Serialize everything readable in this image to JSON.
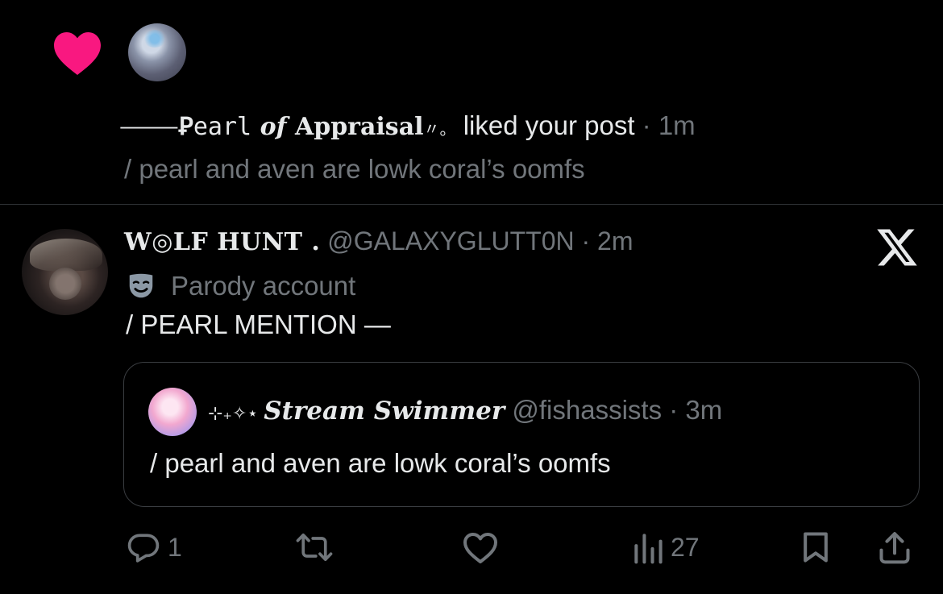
{
  "notification": {
    "liker_name_parts": {
      "dash": "⸻",
      "p1": "Ꝑ",
      "p2": "earl",
      "p3": " of ",
      "p4": "Appraisal",
      "p5": "〃。"
    },
    "action_text": " liked your post",
    "separator": " · ",
    "time": "1m",
    "snippet": "/  pearl and aven are lowk coral’s oomfs"
  },
  "post": {
    "display_name": "W◎LF HUNT .",
    "handle": "@GALAXYGLUTT0N",
    "separator": " · ",
    "time": "2m",
    "badge_label": "Parody account",
    "text": "/ PEARL MENTION —",
    "quote": {
      "stars": "⊹₊✧⋆ ",
      "display_name": "Stream Swimmer",
      "handle": "@fishassists",
      "separator": " · ",
      "time": "3m",
      "text": "/  pearl and aven are lowk coral’s oomfs"
    },
    "actions": {
      "reply_count": "1",
      "repost_count": "",
      "like_count": "",
      "views_count": "27"
    }
  },
  "colors": {
    "background": "#000000",
    "text": "#e7e9ea",
    "muted": "#71767b",
    "like_heart": "#f91880",
    "border": "#2f3336"
  },
  "icons": [
    "heart-icon",
    "x-logo-icon",
    "parody-mask-icon",
    "reply-icon",
    "repost-icon",
    "like-icon",
    "views-icon",
    "bookmark-icon",
    "share-icon"
  ]
}
